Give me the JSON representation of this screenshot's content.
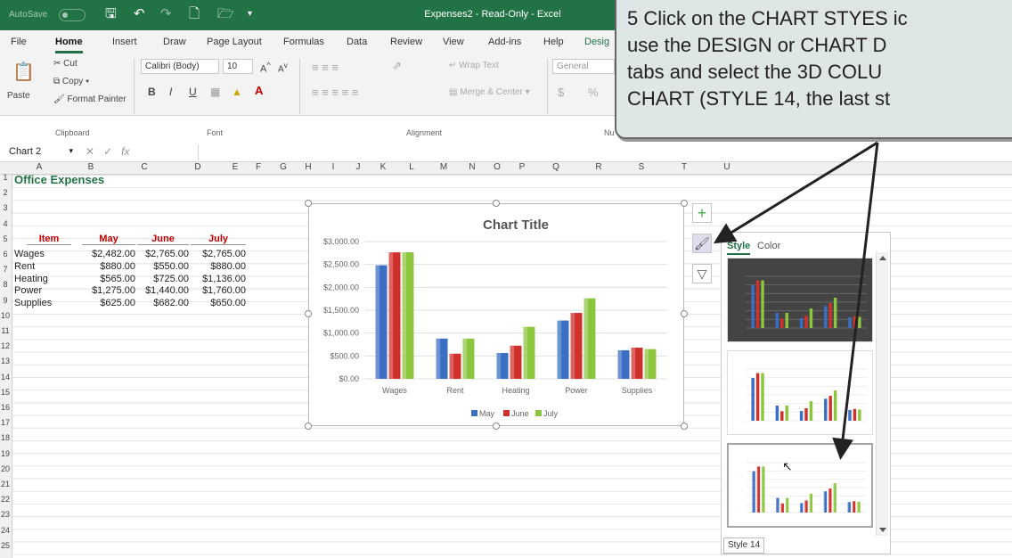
{
  "titlebar": {
    "autosave": "AutoSave",
    "autosave_state": "Off",
    "window_title": "Expenses2 - Read-Only - Excel"
  },
  "tabs": [
    "File",
    "Home",
    "Insert",
    "Draw",
    "Page Layout",
    "Formulas",
    "Data",
    "Review",
    "View",
    "Add-ins",
    "Help",
    "Desig"
  ],
  "ribbon": {
    "clipboard": {
      "paste": "Paste",
      "cut": "Cut",
      "copy": "Copy",
      "format_painter": "Format Painter",
      "group": "Clipboard"
    },
    "font": {
      "font_name": "Calibri (Body)",
      "font_size": "10",
      "bold": "B",
      "italic": "I",
      "underline": "U",
      "group": "Font"
    },
    "alignment": {
      "wrap_text": "Wrap Text",
      "merge_center": "Merge & Center",
      "group": "Alignment"
    },
    "number": {
      "format": "General",
      "currency": "$",
      "percent": "%",
      "group": "Nu"
    }
  },
  "formula_bar": {
    "name_box": "Chart 2",
    "fx": "fx",
    "value": ""
  },
  "columns": [
    "A",
    "B",
    "C",
    "D",
    "E",
    "F",
    "G",
    "H",
    "I",
    "J",
    "K",
    "L",
    "M",
    "N",
    "O",
    "P",
    "Q",
    "R",
    "S",
    "T",
    "U"
  ],
  "rows": [
    "1",
    "2",
    "3",
    "4",
    "5",
    "6",
    "7",
    "8",
    "9",
    "10",
    "11",
    "12",
    "13",
    "14",
    "15",
    "16",
    "17",
    "18",
    "19",
    "20",
    "21",
    "22",
    "23",
    "24",
    "25"
  ],
  "sheet": {
    "title": "Office Expenses",
    "headers": [
      "Item",
      "May",
      "June",
      "July"
    ],
    "rows": [
      [
        "Wages",
        "$2,482.00",
        "$2,765.00",
        "$2,765.00"
      ],
      [
        "Rent",
        "$880.00",
        "$550.00",
        "$880.00"
      ],
      [
        "Heating",
        "$565.00",
        "$725.00",
        "$1,136.00"
      ],
      [
        "Power",
        "$1,275.00",
        "$1,440.00",
        "$1,760.00"
      ],
      [
        "Supplies",
        "$625.00",
        "$682.00",
        "$650.00"
      ]
    ]
  },
  "chart_data": {
    "type": "bar",
    "title": "Chart Title",
    "categories": [
      "Wages",
      "Rent",
      "Heating",
      "Power",
      "Supplies"
    ],
    "series": [
      {
        "name": "May",
        "values": [
          2482,
          880,
          565,
          1275,
          625
        ],
        "color": "#3a6fc4"
      },
      {
        "name": "June",
        "values": [
          2765,
          550,
          725,
          1440,
          682
        ],
        "color": "#d0312d"
      },
      {
        "name": "July",
        "values": [
          2765,
          880,
          1136,
          1760,
          650
        ],
        "color": "#8cc63f"
      }
    ],
    "ylim": [
      0,
      3000
    ],
    "yticks": [
      "$0.00",
      "$500.00",
      "$1,000.00",
      "$1,500.00",
      "$2,000.00",
      "$2,500.00",
      "$3,000.00"
    ],
    "grid": true,
    "legend": "bottom"
  },
  "style_panel": {
    "tab_style": "Style",
    "tab_color": "Color",
    "thumb_label": "Chart Title",
    "tooltip": "Style 14"
  },
  "callout": {
    "lines": [
      "5  Click on the CHART STYES ic",
      "    use the DESIGN or CHART D",
      "    tabs and select the 3D COLU",
      "    CHART (STYLE 14, the last st"
    ]
  },
  "colors": {
    "excel_green": "#217346",
    "accent_red": "#c00000",
    "header_green": "#217346"
  }
}
